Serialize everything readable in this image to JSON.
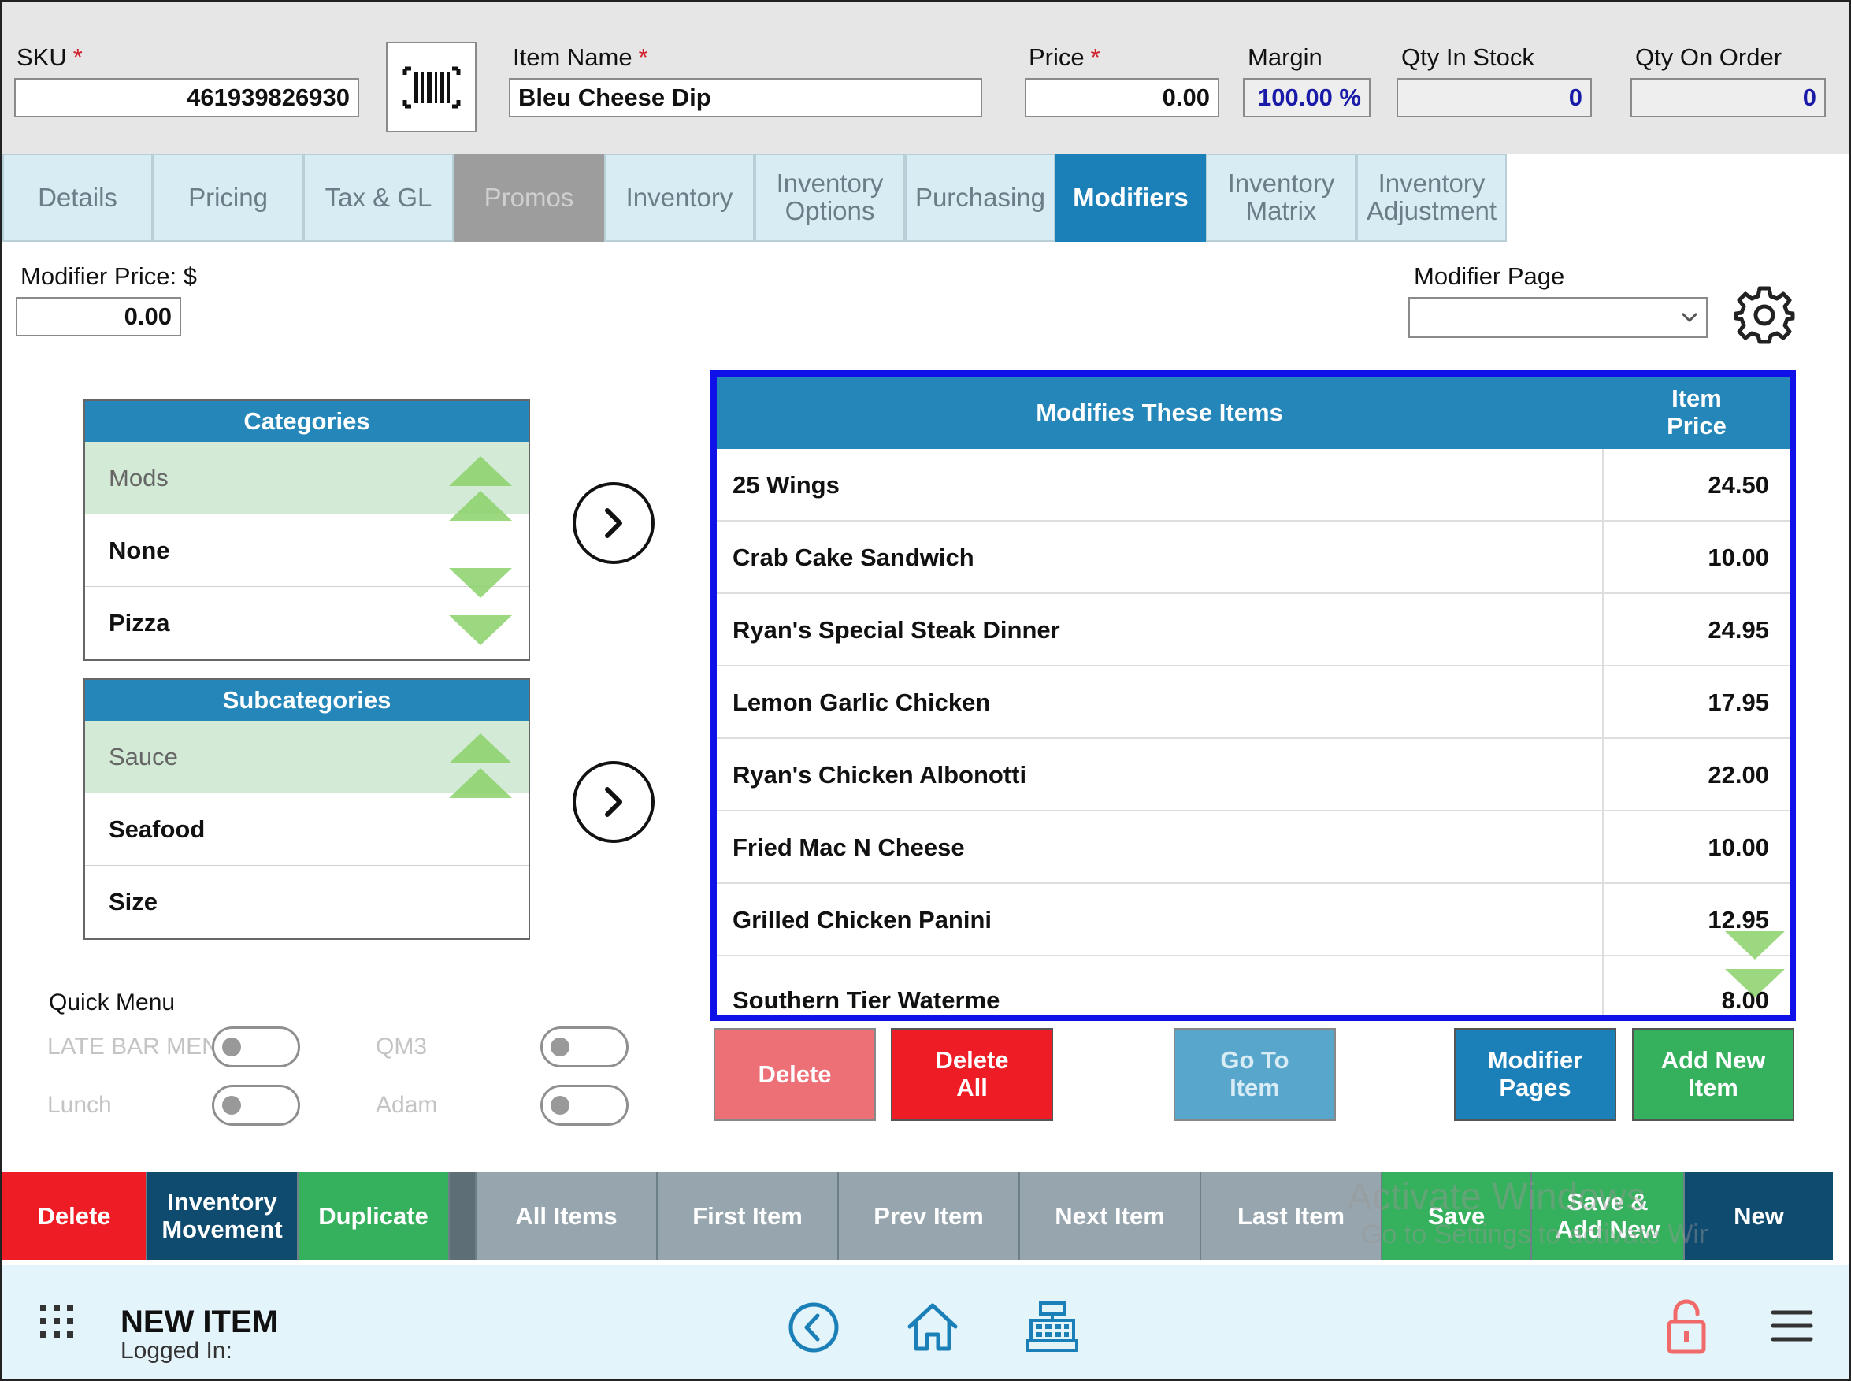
{
  "header": {
    "sku_label": "SKU",
    "required_mark": "*",
    "sku_value": "461939826930",
    "item_name_label": "Item Name",
    "item_name_value": "Bleu Cheese Dip",
    "price_label": "Price",
    "price_value": "0.00",
    "margin_label": "Margin",
    "margin_value": "100.00 %",
    "qty_in_stock_label": "Qty In Stock",
    "qty_in_stock_value": "0",
    "qty_on_order_label": "Qty On Order",
    "qty_on_order_value": "0"
  },
  "tabs": [
    {
      "label": "Details",
      "state": "normal"
    },
    {
      "label": "Pricing",
      "state": "normal"
    },
    {
      "label": "Tax & GL",
      "state": "normal"
    },
    {
      "label": "Promos",
      "state": "disabled"
    },
    {
      "label": "Inventory",
      "state": "normal"
    },
    {
      "label": "Inventory Options",
      "state": "normal"
    },
    {
      "label": "Purchasing",
      "state": "normal"
    },
    {
      "label": "Modifiers",
      "state": "active"
    },
    {
      "label": "Inventory Matrix",
      "state": "normal"
    },
    {
      "label": "Inventory Adjustment",
      "state": "normal"
    }
  ],
  "modifier": {
    "price_label": "Modifier Price: $",
    "price_value": "0.00",
    "page_label": "Modifier Page",
    "page_value": ""
  },
  "categories": {
    "title": "Categories",
    "items": [
      "Mods",
      "None",
      "Pizza"
    ],
    "selected": "Mods"
  },
  "subcategories": {
    "title": "Subcategories",
    "items": [
      "Sauce",
      "Seafood",
      "Size"
    ],
    "selected": "Sauce"
  },
  "grid": {
    "col_name": "Modifies These Items",
    "col_price": "Item Price",
    "rows": [
      {
        "name": "25 Wings",
        "price": "24.50"
      },
      {
        "name": "Crab Cake Sandwich",
        "price": "10.00"
      },
      {
        "name": "Ryan's Special Steak Dinner",
        "price": "24.95"
      },
      {
        "name": "Lemon Garlic Chicken",
        "price": "17.95"
      },
      {
        "name": "Ryan's Chicken Albonotti",
        "price": "22.00"
      },
      {
        "name": "Fried Mac N Cheese",
        "price": "10.00"
      },
      {
        "name": "Grilled Chicken Panini",
        "price": "12.95"
      },
      {
        "name": "Southern Tier Waterme",
        "price": "8.00"
      }
    ]
  },
  "action_buttons": {
    "delete": "Delete",
    "delete_all": "Delete All",
    "go_to_item": "Go To Item",
    "modifier_pages": "Modifier Pages",
    "add_new_item": "Add New Item"
  },
  "quick_menu": {
    "title": "Quick Menu",
    "toggles": [
      {
        "label": "LATE BAR MENU"
      },
      {
        "label": "QM3"
      },
      {
        "label": "Lunch"
      },
      {
        "label": "Adam"
      }
    ]
  },
  "bottom_bar": {
    "delete": "Delete",
    "inventory_movement": "Inventory Movement",
    "duplicate": "Duplicate",
    "all_items": "All Items",
    "first_item": "First Item",
    "prev_item": "Prev Item",
    "next_item": "Next Item",
    "last_item": "Last Item",
    "save": "Save",
    "save_add_new": "Save & Add New",
    "new": "New"
  },
  "watermark": {
    "line1": "Activate Windows",
    "line2": "Go to Settings to activate Windows."
  },
  "footer": {
    "title": "NEW ITEM",
    "logged_in_label": "Logged In:"
  },
  "colors": {
    "accent_blue": "#1b7fb8",
    "header_blue": "#2486b9",
    "delete_red": "#ee1c24",
    "success_green": "#35b05c",
    "navy": "#0f4a6f",
    "grid_border": "#1010e8"
  }
}
